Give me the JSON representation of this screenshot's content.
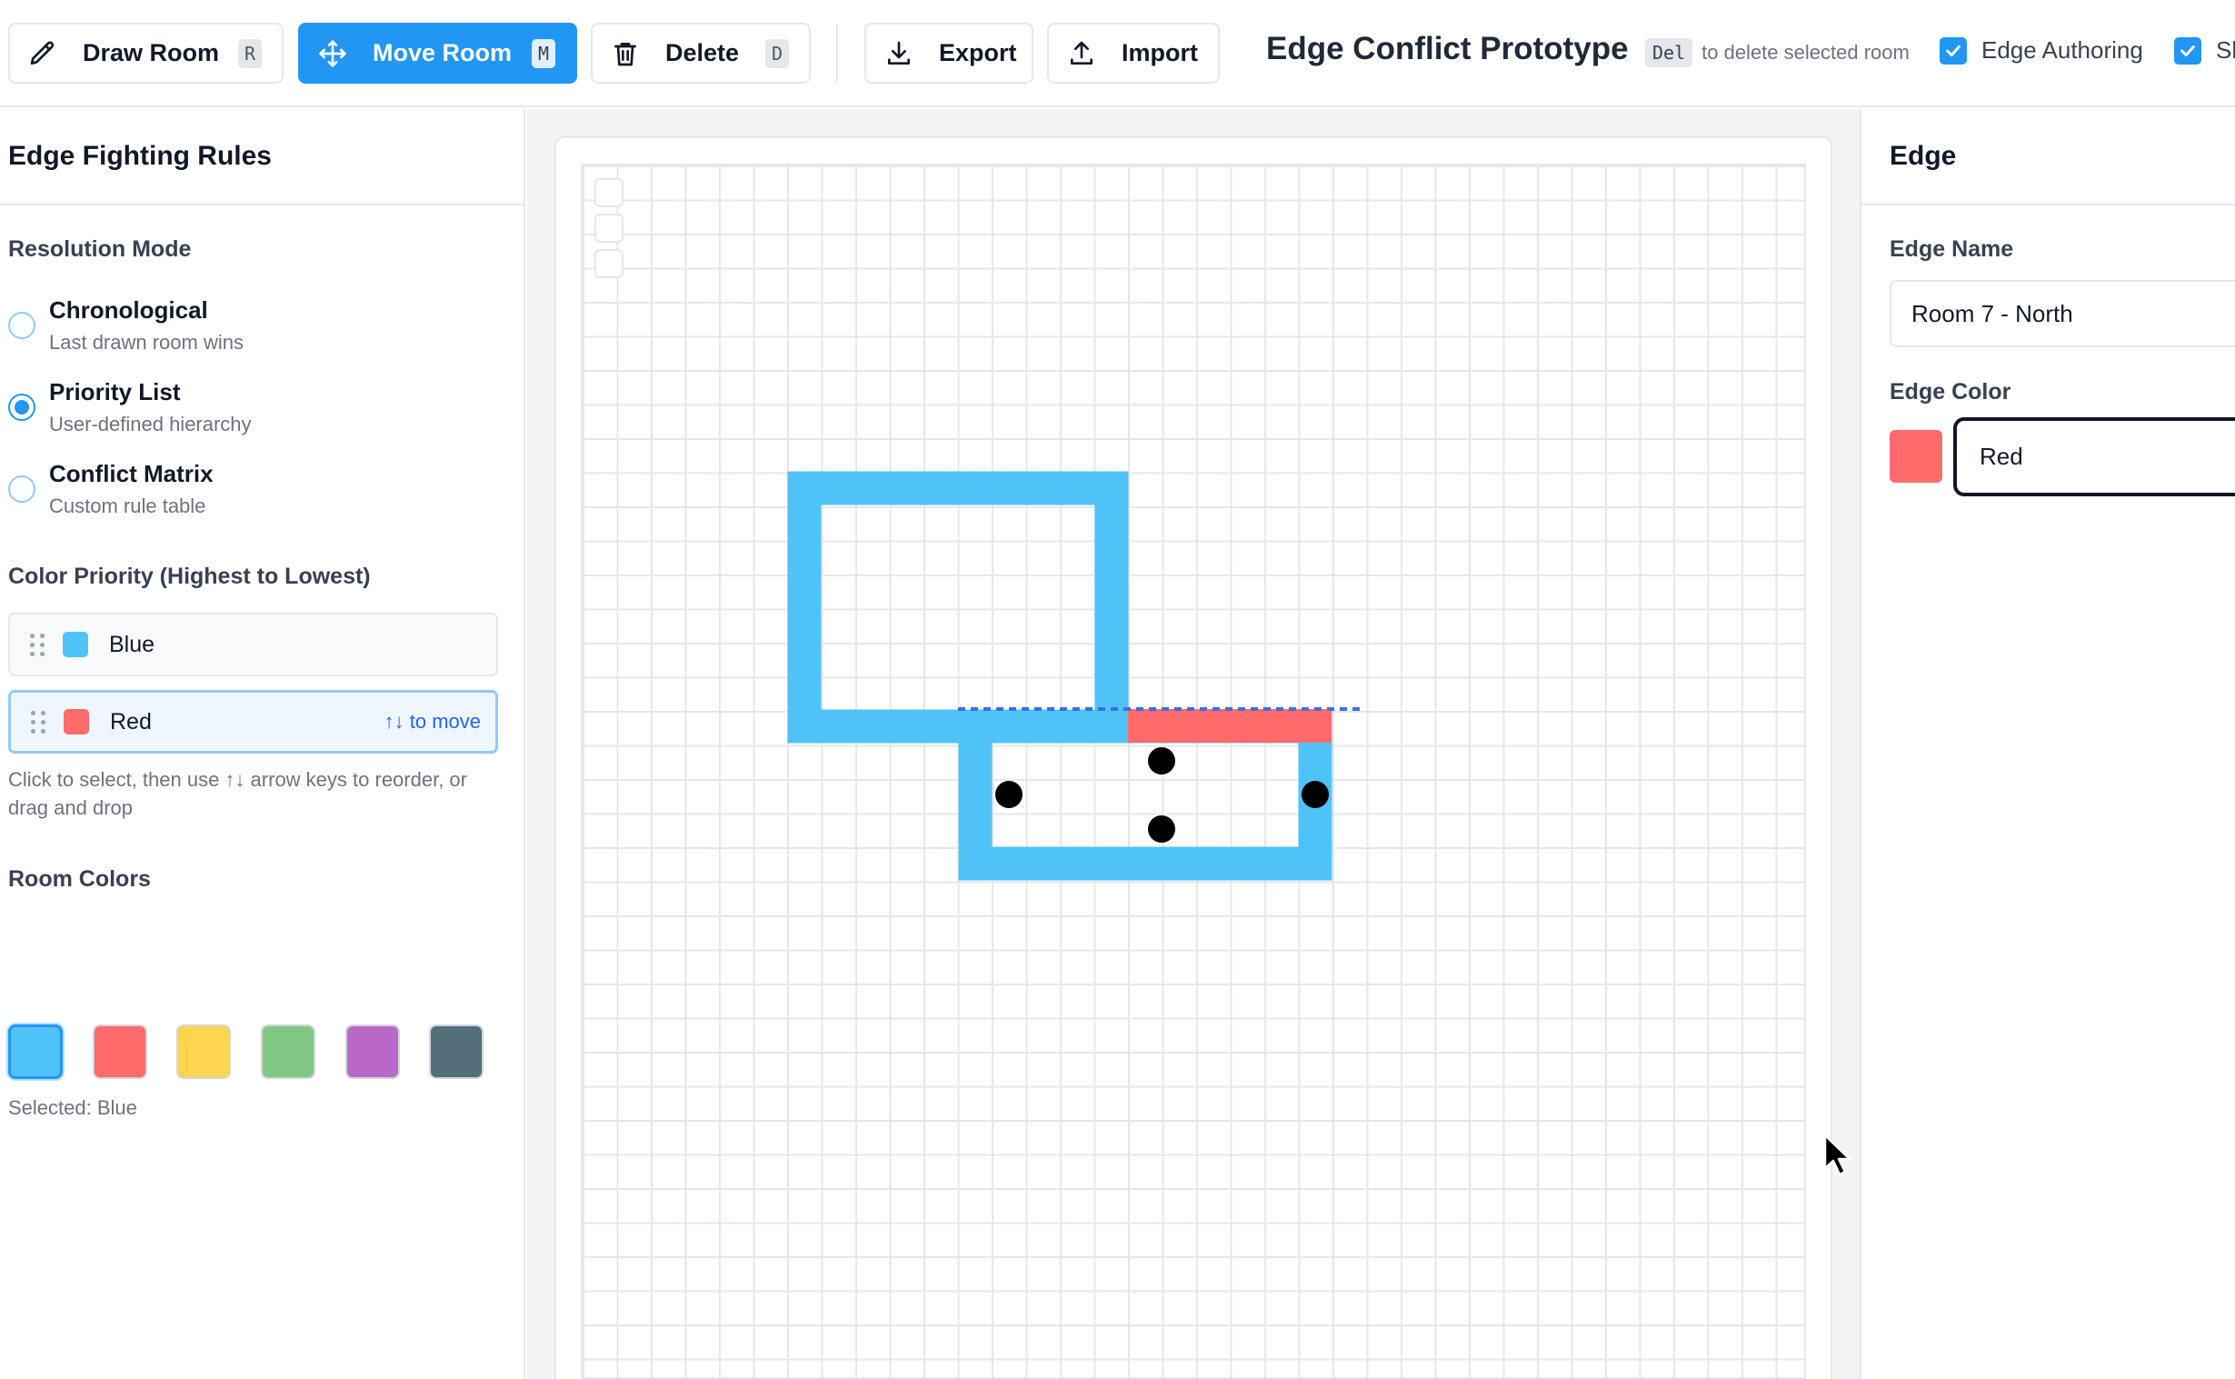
{
  "toolbar": {
    "draw_room": {
      "label": "Draw Room",
      "shortcut": "R",
      "icon": "pencil-icon"
    },
    "move_room": {
      "label": "Move Room",
      "shortcut": "M",
      "icon": "move-arrows-icon"
    },
    "delete": {
      "label": "Delete",
      "shortcut": "D",
      "icon": "trash-icon"
    },
    "export": {
      "label": "Export",
      "icon": "download-icon"
    },
    "import": {
      "label": "Import",
      "icon": "upload-icon"
    },
    "app_title": "Edge Conflict Prototype",
    "hint_key": "Del",
    "hint_text": "to delete selected room",
    "edge_authoring": {
      "label": "Edge Authoring",
      "checked": true
    },
    "third_toggle": {
      "label": "Sh",
      "checked": true
    }
  },
  "left_panel": {
    "title": "Edge Fighting Rules",
    "resolution_mode": {
      "title": "Resolution Mode",
      "selected": "Priority List",
      "options": [
        {
          "label": "Chronological",
          "desc": "Last drawn room wins"
        },
        {
          "label": "Priority List",
          "desc": "User-defined hierarchy"
        },
        {
          "label": "Conflict Matrix",
          "desc": "Custom rule table"
        }
      ]
    },
    "color_priority": {
      "title": "Color Priority (Highest to Lowest)",
      "items": [
        {
          "label": "Blue",
          "color": "#4fc3f7"
        },
        {
          "label": "Red",
          "color": "#ff6b6b",
          "hint": "↑↓ to move"
        }
      ],
      "help": "Click to select, then use ↑↓ arrow keys to reorder, or drag and drop"
    },
    "room_colors": {
      "title": "Room Colors",
      "swatches": [
        "#4fc3f7",
        "#ff6b6b",
        "#ffd54f",
        "#81c784",
        "#ba68c8",
        "#546e7a"
      ],
      "selected_label": "Selected: Blue"
    }
  },
  "right_panel": {
    "title": "Edge",
    "edge_name_label": "Edge Name",
    "edge_name_value": "Room 7 - North",
    "edge_color_label": "Edge Color",
    "edge_color_value": "Red",
    "edge_color_hex": "#ff6b6b"
  },
  "colors": {
    "accent": "#2196f3",
    "room_blue": "#4fc3f7",
    "edge_red": "#ff6b6b"
  }
}
